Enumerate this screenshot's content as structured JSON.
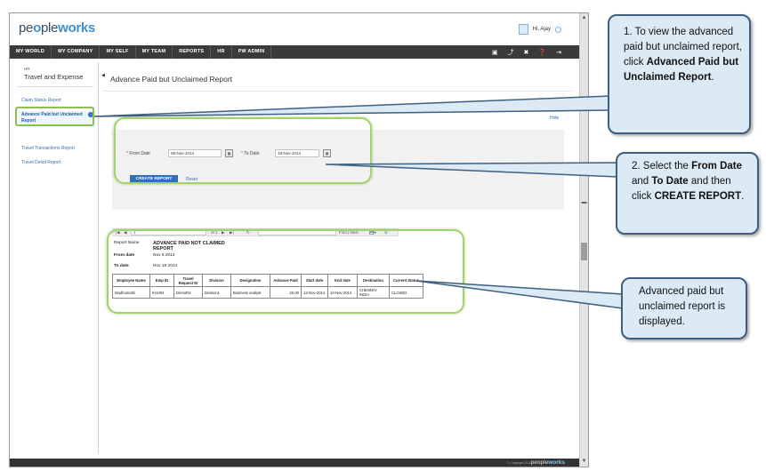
{
  "app": {
    "logo_prefix": "pe",
    "logo_mid": "o",
    "logo_main": "ple",
    "logo_accent": "works",
    "user_greeting": "Hi, Ajay"
  },
  "nav": {
    "items": [
      "MY WORLD",
      "MY COMPANY",
      "MY SELF",
      "MY TEAM",
      "REPORTS",
      "HR",
      "PW ADMIN"
    ],
    "icons": [
      "book-icon",
      "pin-icon",
      "tools-icon",
      "help-icon",
      "logout-icon"
    ]
  },
  "sidebar": {
    "module_small": "HR",
    "module_title": "Travel and Expense",
    "items": [
      {
        "label": "Claim Status Report"
      },
      {
        "label": "Advance Paid but Unclaimed Report"
      },
      {
        "label": "Travel Transactions Report"
      },
      {
        "label": "Travel Detail Report"
      }
    ]
  },
  "main": {
    "page_title": "Advance Paid but Unclaimed Report",
    "more_link": "Hide"
  },
  "filter": {
    "from_label": "From Date",
    "from_value": "05-Nov-2014",
    "to_label": "To Date",
    "to_value": "19-Nov-2014",
    "required_mark": "*",
    "create_button": "CREATE REPORT",
    "reset_link": "Reset"
  },
  "report_toolbar": {
    "page_box": "1",
    "page_of": "of 1",
    "find_next": "Find | Next"
  },
  "report": {
    "name_label": "Report Name",
    "name_value": "ADVANCE PAID NOT CLAIMED REPORT",
    "from_label": "From date",
    "from_value": "Nov 5 2014",
    "to_label": "To date",
    "to_value": "Nov 19 2014",
    "columns": [
      "Employee Name",
      "Emp ID",
      "Travel Request ID",
      "Division",
      "Designation",
      "Advance Paid",
      "Start date",
      "End date",
      "Destination",
      "Current Status"
    ],
    "rows": [
      [
        "Madhumathi",
        "IH1004",
        "DemoR4",
        "Division1",
        "Business analyst",
        "25.00",
        "12-Nov-2014",
        "10-Nov-2014",
        "CHENNAI-INDIA",
        "CLOSED"
      ]
    ]
  },
  "footer": {
    "copyright": "© Copyright 2014",
    "logo_main": "people",
    "logo_accent": "works"
  },
  "callouts": {
    "c1_pre": "1. To view the advanced paid but unclaimed report, click ",
    "c1_bold": "Advanced Paid but Unclaimed Report",
    "c1_post": ".",
    "c2_pre": "2. Select the ",
    "c2_b1": "From Date",
    "c2_mid1": " and ",
    "c2_b2": "To Date",
    "c2_mid2": " and then click ",
    "c2_b3": "CREATE REPORT",
    "c2_post": ".",
    "c3": "Advanced paid but unclaimed report is displayed."
  },
  "colors": {
    "accent": "#2f6fb8",
    "highlight": "#8cc152",
    "callout_bg": "#dbeaf4",
    "callout_border": "#3f5f7f",
    "navbar": "#3a3a3a"
  }
}
